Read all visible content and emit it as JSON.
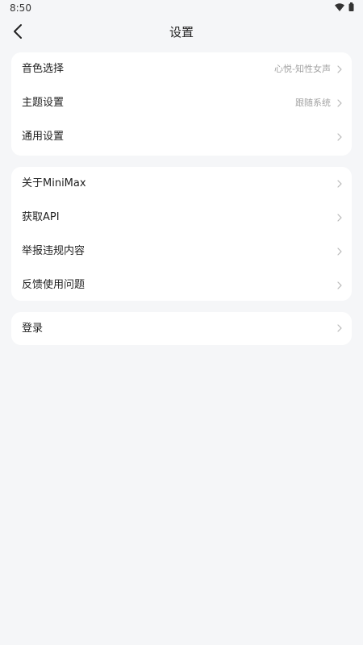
{
  "status_bar": {
    "time": "8:50",
    "icons": [
      "wifi-icon",
      "battery-icon"
    ]
  },
  "header": {
    "title": "设置",
    "back_icon": "chevron-left-icon"
  },
  "groups": [
    {
      "items": [
        {
          "label": "音色选择",
          "value": "心悦-知性女声"
        },
        {
          "label": "主题设置",
          "value": "跟随系统"
        },
        {
          "label": "通用设置",
          "value": ""
        }
      ]
    },
    {
      "items": [
        {
          "label": "关于MiniMax",
          "value": ""
        },
        {
          "label": "获取API",
          "value": ""
        },
        {
          "label": "举报违规内容",
          "value": ""
        },
        {
          "label": "反馈使用问题",
          "value": ""
        }
      ]
    },
    {
      "items": [
        {
          "label": "登录",
          "value": ""
        }
      ]
    }
  ],
  "colors": {
    "page_background": "#f5f6f8",
    "card_background": "#ffffff",
    "label_text": "#1f1f1f",
    "value_text": "#a3a3a3",
    "chevron": "#b8b8b8"
  }
}
